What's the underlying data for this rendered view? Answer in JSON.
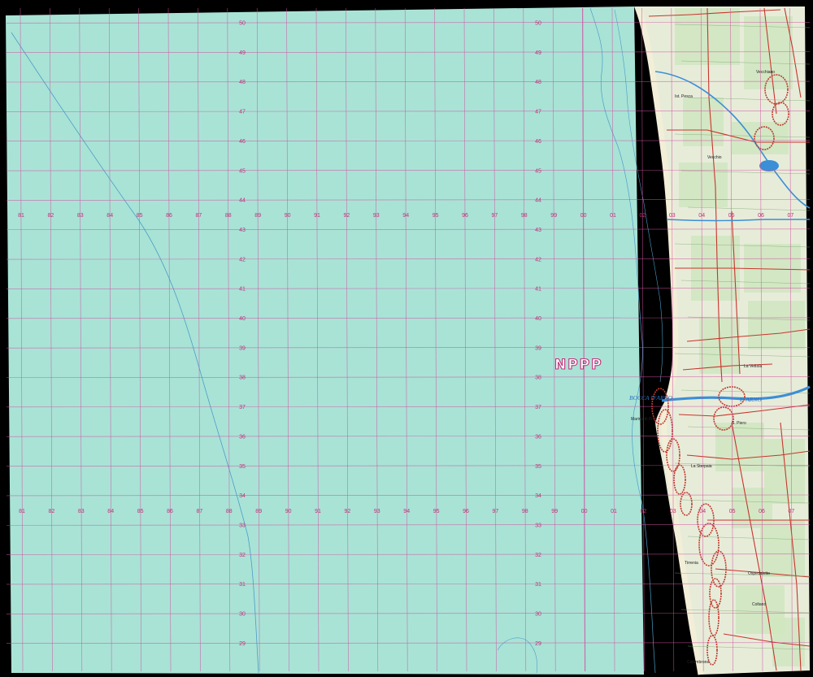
{
  "map": {
    "sheet_code": "NPPP",
    "colors": {
      "sea": "#a9e3d6",
      "land": "#e7ecd9",
      "farmland": "#cfe6c0",
      "beach": "#f3eed8",
      "grid": "#d050a0",
      "grid_label": "#c0307a",
      "road": "#c9342c",
      "urban": "#c23a2f",
      "water": "#3b8fd6",
      "depth_contour": "#4a9ec8",
      "frame": "#000000"
    },
    "easting_labels_row_top": [
      "81",
      "82",
      "83",
      "84",
      "85",
      "86",
      "87",
      "88",
      "89",
      "90",
      "91",
      "92",
      "93",
      "94",
      "95",
      "96",
      "97",
      "98",
      "99",
      "00",
      "01",
      "02",
      "03",
      "04",
      "05",
      "06",
      "07"
    ],
    "easting_labels_row_bottom": [
      "81",
      "82",
      "83",
      "84",
      "85",
      "86",
      "87",
      "88",
      "89",
      "90",
      "91",
      "92",
      "93",
      "94",
      "95",
      "96",
      "97",
      "98",
      "99",
      "00",
      "01",
      "02",
      "03",
      "04",
      "05",
      "06",
      "07"
    ],
    "northing_labels": [
      "50",
      "49",
      "48",
      "47",
      "46",
      "45",
      "44",
      "43",
      "42",
      "41",
      "40",
      "39",
      "38",
      "37",
      "36",
      "35",
      "34",
      "33",
      "32",
      "31",
      "30",
      "29"
    ],
    "places": [
      {
        "name": "BOCCA D'ARNO",
        "kind": "river-mouth"
      },
      {
        "name": "F. ARNO",
        "kind": "river"
      },
      {
        "name": "Marina di Pisa",
        "kind": "town"
      },
      {
        "name": "Tirrenia",
        "kind": "town"
      },
      {
        "name": "Calambrone",
        "kind": "town"
      },
      {
        "name": "S. Piero",
        "kind": "village"
      },
      {
        "name": "Vecchiano",
        "kind": "village"
      },
      {
        "name": "La Vettola",
        "kind": "village"
      },
      {
        "name": "Ospedaletto",
        "kind": "village"
      },
      {
        "name": "Ist. Pesca",
        "kind": "locality"
      },
      {
        "name": "Coltano",
        "kind": "locality"
      },
      {
        "name": "Vecchio",
        "kind": "locality"
      },
      {
        "name": "La Sterpaia",
        "kind": "locality"
      }
    ]
  }
}
